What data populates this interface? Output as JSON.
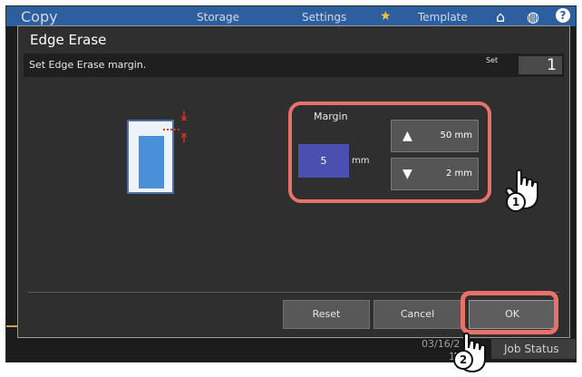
{
  "topbar": {
    "app_title": "Copy",
    "tabs": [
      "Storage",
      "Settings",
      "Template"
    ],
    "template_star_icon": "star-icon",
    "home_icon": "home-icon",
    "globe_icon": "globe-icon",
    "help_icon": "help-icon"
  },
  "background": {
    "date_text": "03/16/2",
    "time_text": "15",
    "job_status_label": "Job Status"
  },
  "dialog": {
    "title": "Edge Erase",
    "message": "Set Edge Erase margin.",
    "set_label": "Set",
    "set_value": "1"
  },
  "margin": {
    "label": "Margin",
    "value": "5",
    "unit": "mm",
    "up_label": "50 mm",
    "down_label": "2 mm"
  },
  "actions": {
    "reset_label": "Reset",
    "cancel_label": "Cancel",
    "ok_label": "OK"
  },
  "callouts": {
    "step1": "1",
    "step2": "2"
  },
  "colors": {
    "accent": "#2d5f9e",
    "highlight": "#e8716a",
    "value_field": "#4a4fb0",
    "arrow_red": "#e23030"
  }
}
